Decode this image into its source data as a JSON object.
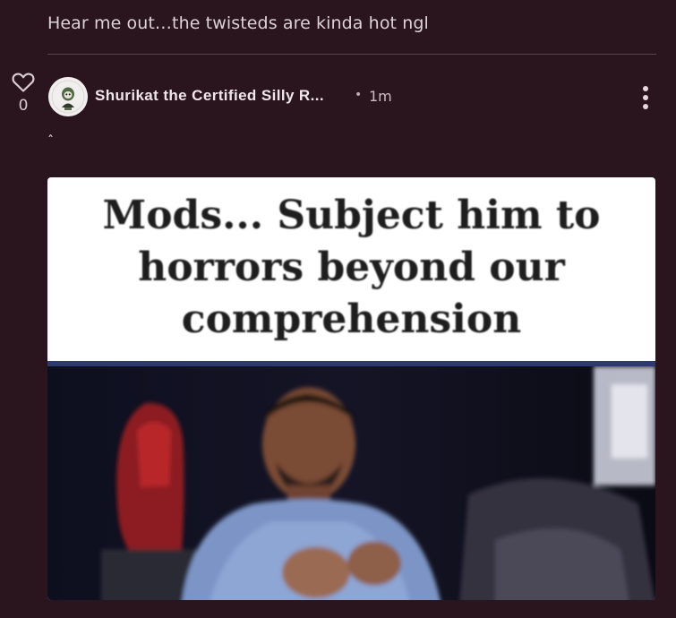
{
  "previous_reply": {
    "text": "Hear me out…the twisteds are kinda hot ngl"
  },
  "post": {
    "vote_count": "0",
    "author": "Shurikat the Certified Silly R...",
    "separator": "•",
    "time": "1m",
    "body_text": "ˆ",
    "meme_caption": {
      "line1": "Mods... Subject him to",
      "line2": "horrors beyond our",
      "line3": "comprehension"
    }
  },
  "icons": {
    "like": "heart-outline-icon",
    "menu": "vertical-dots-icon"
  },
  "colors": {
    "background": "#2a151e",
    "divider": "#58434c",
    "text": "#e9dde3",
    "muted": "#cbbcc4"
  }
}
